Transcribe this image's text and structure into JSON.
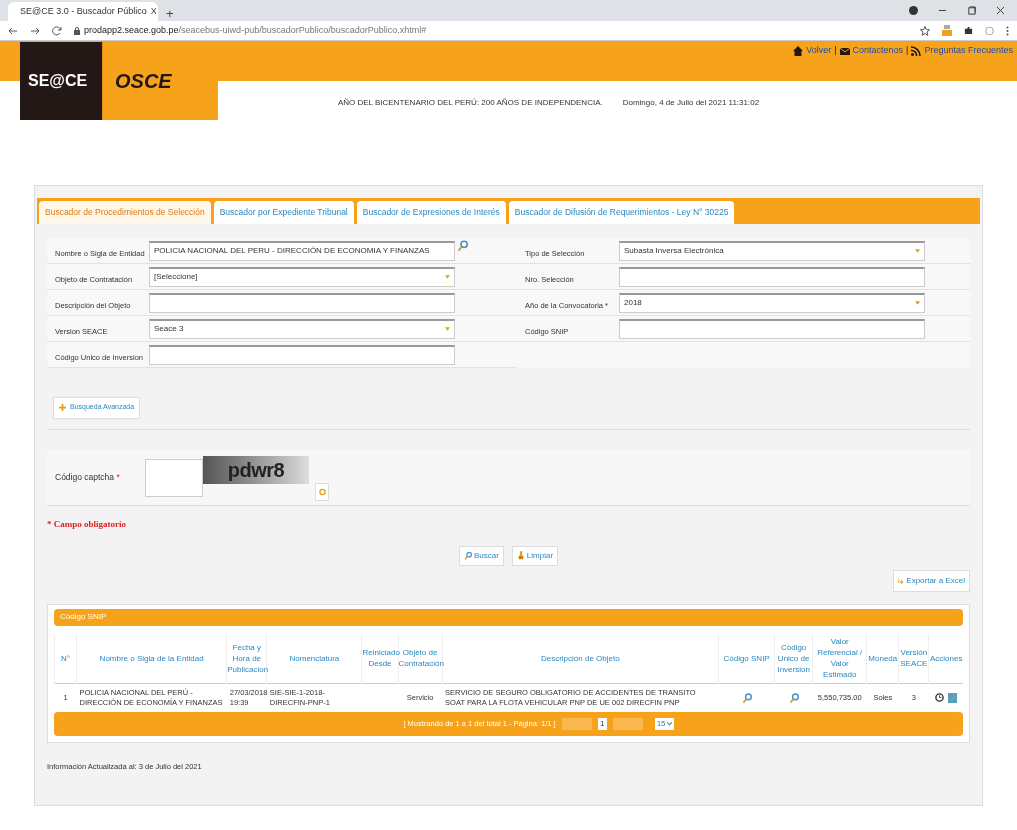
{
  "browser": {
    "tab_title": "SE@CE 3.0 - Buscador Público",
    "tab_close": "X",
    "new_tab": "+",
    "url_host": "prodapp2.seace.gob.pe",
    "url_path": "/seacebus-uiwd-pub/buscadorPublico/buscadorPublico.xhtml#"
  },
  "header": {
    "logo": "SE@CE",
    "logo2": "OSCE",
    "links": [
      "Volver",
      "Contactenos",
      "Preguntas Frecuentes"
    ],
    "separators": [
      "|",
      "|"
    ],
    "motto": "AÑO DEL BICENTENARIO DEL PERÚ: 200 AÑOS DE INDEPENDENCIA.",
    "date": "Domingo, 4 de Julio del 2021 11:31:02"
  },
  "tabs": [
    {
      "label": "Buscador de Procedimientos de Selección",
      "selected": true
    },
    {
      "label": "Buscador por Expediente Tribunal",
      "selected": false
    },
    {
      "label": "Buscador de Expresiones de Interés",
      "selected": false
    },
    {
      "label": "Buscador de Difusión de Requerimientos - Ley N° 30225",
      "selected": false
    }
  ],
  "form": {
    "left": [
      {
        "label": "Nombre o Sigla de Entidad",
        "kind": "lookup",
        "value": "POLICIA NACIONAL DEL PERU - DIRECCIÓN DE ECONOMIA Y FINANZAS"
      },
      {
        "label": "Objeto de Contratación",
        "kind": "select",
        "value": "[Seleccione]"
      },
      {
        "label": "Descripción del Objeto",
        "kind": "text"
      },
      {
        "label": "Version SEACE",
        "kind": "select",
        "value": "Seace 3"
      },
      {
        "label": "Código Unico de Inversion",
        "kind": "text"
      }
    ],
    "right": [
      {
        "label": "Tipo de Selección",
        "kind": "select",
        "value": "Subasta Inversa Electrónica"
      },
      {
        "label": "Nro. Selección",
        "kind": "text"
      },
      {
        "label": "Año de la Convocatoria *",
        "kind": "select",
        "value": "2018"
      },
      {
        "label": "Código SNIP",
        "kind": "text"
      }
    ]
  },
  "advanced_button": "Búsqueda Avanzada",
  "captcha": {
    "label": "Código captcha",
    "required_mark": "*",
    "image_text": "pdwr8"
  },
  "required_note": "* Campo obligatorio",
  "actions": [
    "Buscar",
    "Limpiar"
  ],
  "export": "Exportar a Excel",
  "results": {
    "title": "Código SNIP",
    "columns": [
      "N°",
      "Nombre o Sigla de la Entidad",
      "Fecha y Hora de Publicacion",
      "Nomenclatura",
      "Reiniciado Desde",
      "Objeto de Contratación",
      "Descripción de Objeto",
      "Código SNIP",
      "Código Unico de Inversion",
      "Valor Referencial / Valor Estimado",
      "Moneda",
      "Versión SEACE",
      "Acciones"
    ],
    "rows": [
      [
        {
          "kind": "text",
          "text": "1"
        },
        {
          "kind": "text",
          "text": "POLICIA NACIONAL DEL PERÚ - DIRECCIÓN DE ECONOMÍA Y FINANZAS"
        },
        {
          "kind": "text",
          "text": "27/03/2018 19:39"
        },
        {
          "kind": "text",
          "text": "SIE-SIE-1-2018-DIRECFIN-PNP-1"
        },
        {
          "kind": "blank"
        },
        {
          "kind": "text",
          "text": "Servicio"
        },
        {
          "kind": "text",
          "text": "SERVICIO DE SEGURO OBLIGATORIO DE ACCIDENTES DE TRANSITO SOAT PARA LA FLOTA VEHICULAR PNP DE UE 002 DIRECFIN PNP"
        },
        {
          "kind": "search"
        },
        {
          "kind": "search"
        },
        {
          "kind": "text",
          "text": "5,550,735.00"
        },
        {
          "kind": "text",
          "text": "Soles"
        },
        {
          "kind": "text",
          "text": "3"
        },
        {
          "kind": "actions"
        }
      ]
    ],
    "pager": {
      "summary": "[ Mostrando de 1 a 1 del total 1 - Página: 1/1 ]",
      "pages": [
        {
          "label": "1",
          "selected": true
        }
      ],
      "page_size": "15"
    }
  },
  "footer": "Información Actualizada al: 3 de Julio del 2021"
}
